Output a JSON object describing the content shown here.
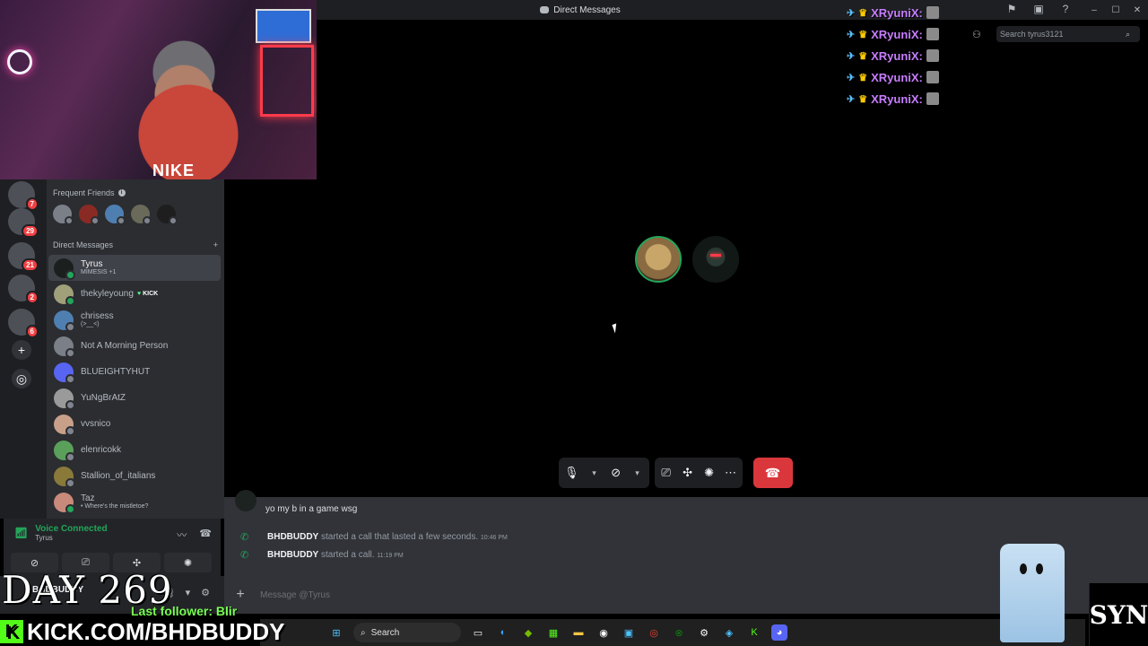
{
  "window": {
    "title": "Direct Messages"
  },
  "webcam": {
    "shirt_text": "NIKE"
  },
  "servers": [
    {
      "badge": "7"
    },
    {
      "badge": "29"
    },
    {
      "badge": "21"
    },
    {
      "badge": "2"
    },
    {
      "badge": "6"
    }
  ],
  "sidebar": {
    "frequent_friends_label": "Frequent Friends",
    "dm_header": "Direct Messages",
    "dms": [
      {
        "name": "Tyrus",
        "sub": "MIMESIS +1",
        "active": true
      },
      {
        "name": "thekyleyoung",
        "tag": "KICK"
      },
      {
        "name": "chrisess",
        "sub": "(>__<)"
      },
      {
        "name": "Not A Morning Person"
      },
      {
        "name": "BLUEIGHTYHUT"
      },
      {
        "name": "YuNgBrAtZ"
      },
      {
        "name": "vvsnico"
      },
      {
        "name": "elenricokk"
      },
      {
        "name": "Stallion_of_italians"
      },
      {
        "name": "Taz",
        "sub": "• Where's the mistletoe?"
      }
    ]
  },
  "voice": {
    "status": "Voice Connected",
    "channel": "Tyrus"
  },
  "user": {
    "name": "BHDBUDDY"
  },
  "overlay": {
    "day": "DAY 269",
    "last_follower": "Last follower: Blir",
    "kick_url": "KICK.COM/BHDBUDDY"
  },
  "pinned": [
    {
      "name": "XRyuniX:"
    },
    {
      "name": "XRyuniX:"
    },
    {
      "name": "XRyuniX:"
    },
    {
      "name": "XRyuniX:"
    },
    {
      "name": "XRyuniX:"
    }
  ],
  "search": {
    "placeholder": "Search tyrus3121"
  },
  "chat": {
    "messages": [
      {
        "text": "yo my b in a game wsg"
      }
    ],
    "system": [
      {
        "user": "BHDBUDDY",
        "action": "started a call that lasted a few seconds.",
        "time": "10:46 PM"
      },
      {
        "user": "BHDBUDDY",
        "action": "started a call.",
        "time": "11:19 PM"
      }
    ],
    "composer_placeholder": "Message @Tyrus"
  },
  "taskbar": {
    "search_label": "Search"
  }
}
